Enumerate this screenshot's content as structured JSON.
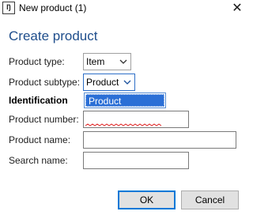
{
  "window": {
    "title": "New product (1)",
    "app_icon_text": "Ŋ",
    "close_glyph": "✕"
  },
  "dialog": {
    "heading": "Create product"
  },
  "form": {
    "product_type_label": "Product type:",
    "product_type_value": "Item",
    "product_subtype_label": "Product subtype:",
    "product_subtype_value": "Product",
    "subtype_options": [
      "Product"
    ],
    "identification_label": "Identification",
    "product_number_label": "Product number:",
    "product_number_value": "",
    "product_name_label": "Product name:",
    "product_name_value": "",
    "search_name_label": "Search name:",
    "search_name_value": ""
  },
  "buttons": {
    "ok_label": "OK",
    "cancel_label": "Cancel"
  },
  "colors": {
    "accent": "#1f4e8c",
    "selection": "#2b6fd6",
    "focus_border": "#0078d7",
    "spellcheck": "#e02020"
  },
  "icons": {
    "app": "dynamics-app-icon",
    "close": "close-icon",
    "dropdown": "chevron-down-icon"
  }
}
